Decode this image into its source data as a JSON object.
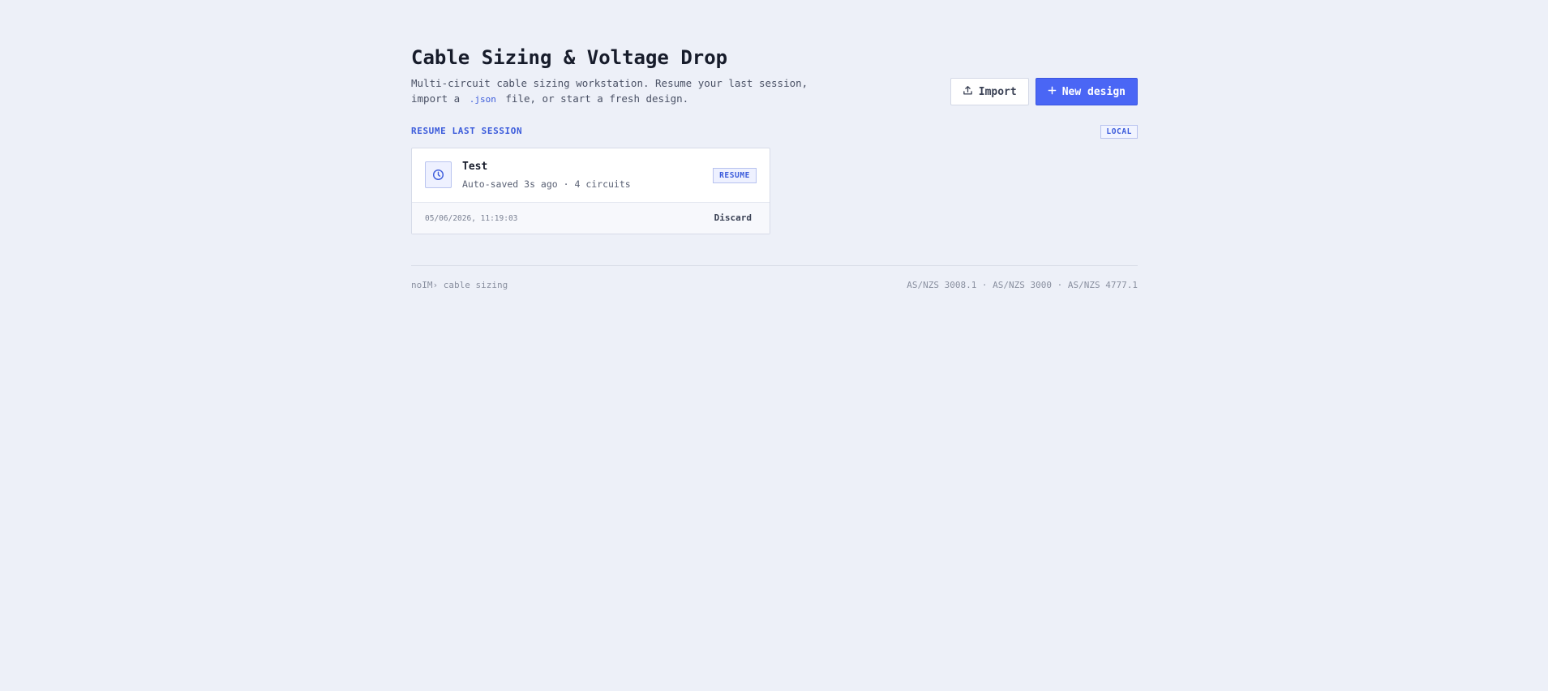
{
  "header": {
    "title": "Cable Sizing & Voltage Drop",
    "subtitle_before": "Multi-circuit cable sizing workstation. Resume your last session, import a",
    "subtitle_code": ".json",
    "subtitle_after": "file, or start a fresh design."
  },
  "actions": {
    "import_label": "Import",
    "new_label": "New design",
    "import_icon": "upload-icon",
    "new_icon": "plus-icon"
  },
  "section": {
    "label": "RESUME LAST SESSION",
    "badge": "LOCAL"
  },
  "session": {
    "icon": "clock-icon",
    "name": "Test",
    "meta": "Auto-saved 3s ago · 4 circuits",
    "resume_label": "RESUME",
    "date": "05/06/2026, 11:19:03",
    "discard_label": "Discard"
  },
  "footer": {
    "brand": "noIM› cable sizing",
    "standards": "AS/NZS 3008.1 · AS/NZS 3000 · AS/NZS 4777.1"
  },
  "colors": {
    "accent": "#4a66f5",
    "background": "#edf0f8"
  }
}
